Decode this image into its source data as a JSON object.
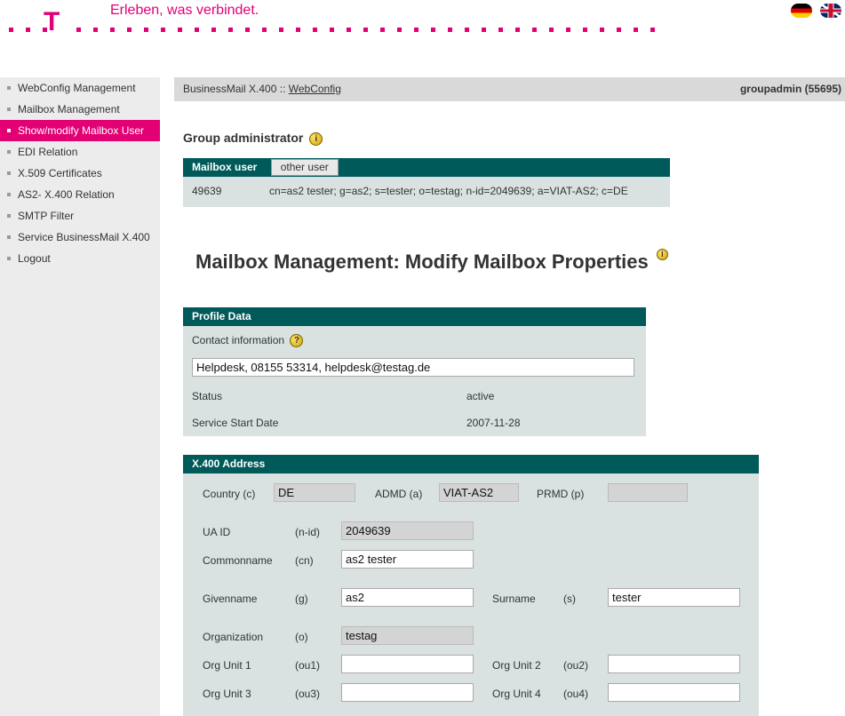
{
  "header": {
    "slogan": "Erleben, was verbindet.",
    "logo_letter": "T",
    "brand_color": "#e20074",
    "flags": [
      "flag-germany-icon",
      "flag-uk-icon"
    ]
  },
  "sidebar": {
    "items": [
      {
        "label": "WebConfig Management",
        "active": false
      },
      {
        "label": "Mailbox Management",
        "active": false
      },
      {
        "label": "Show/modify Mailbox User",
        "active": true
      },
      {
        "label": "EDI Relation",
        "active": false
      },
      {
        "label": "X.509 Certificates",
        "active": false
      },
      {
        "label": "AS2- X.400 Relation",
        "active": false
      },
      {
        "label": "SMTP Filter",
        "active": false
      },
      {
        "label": "Service BusinessMail X.400",
        "active": false
      },
      {
        "label": "Logout",
        "active": false
      }
    ]
  },
  "topbar": {
    "breadcrumb_prefix": "BusinessMail X.400 ::",
    "breadcrumb_link": "WebConfig",
    "user": "groupadmin (55695)"
  },
  "group_admin": {
    "title": "Group administrator"
  },
  "mailbox_user": {
    "tab_active": "Mailbox user",
    "tab_other": "other user",
    "id": "49639",
    "address": "cn=as2 tester; g=as2; s=tester; o=testag; n-id=2049639; a=VIAT-AS2; c=DE"
  },
  "page_title": "Mailbox Management: Modify Mailbox Properties",
  "profile": {
    "header": "Profile Data",
    "contact_label": "Contact information",
    "contact_value": "Helpdesk, 08155 53314, helpdesk@testag.de",
    "status_label": "Status",
    "status_value": "active",
    "start_label": "Service Start Date",
    "start_value": "2007-11-28"
  },
  "x400": {
    "header": "X.400 Address",
    "country_label": "Country (c)",
    "country_value": "DE",
    "admd_label": "ADMD (a)",
    "admd_value": "VIAT-AS2",
    "prmd_label": "PRMD (p)",
    "prmd_value": "",
    "uaid_label": "UA ID",
    "uaid_code": "(n-id)",
    "uaid_value": "2049639",
    "cn_label": "Commonname",
    "cn_code": "(cn)",
    "cn_value": "as2 tester",
    "g_label": "Givenname",
    "g_code": "(g)",
    "g_value": "as2",
    "s_label": "Surname",
    "s_code": "(s)",
    "s_value": "tester",
    "o_label": "Organization",
    "o_code": "(o)",
    "o_value": "testag",
    "ou1_label": "Org Unit 1",
    "ou1_code": "(ou1)",
    "ou1_value": "",
    "ou2_label": "Org Unit 2",
    "ou2_code": "(ou2)",
    "ou2_value": "",
    "ou3_label": "Org Unit 3",
    "ou3_code": "(ou3)",
    "ou3_value": "",
    "ou4_label": "Org Unit 4",
    "ou4_code": "(ou4)",
    "ou4_value": ""
  }
}
